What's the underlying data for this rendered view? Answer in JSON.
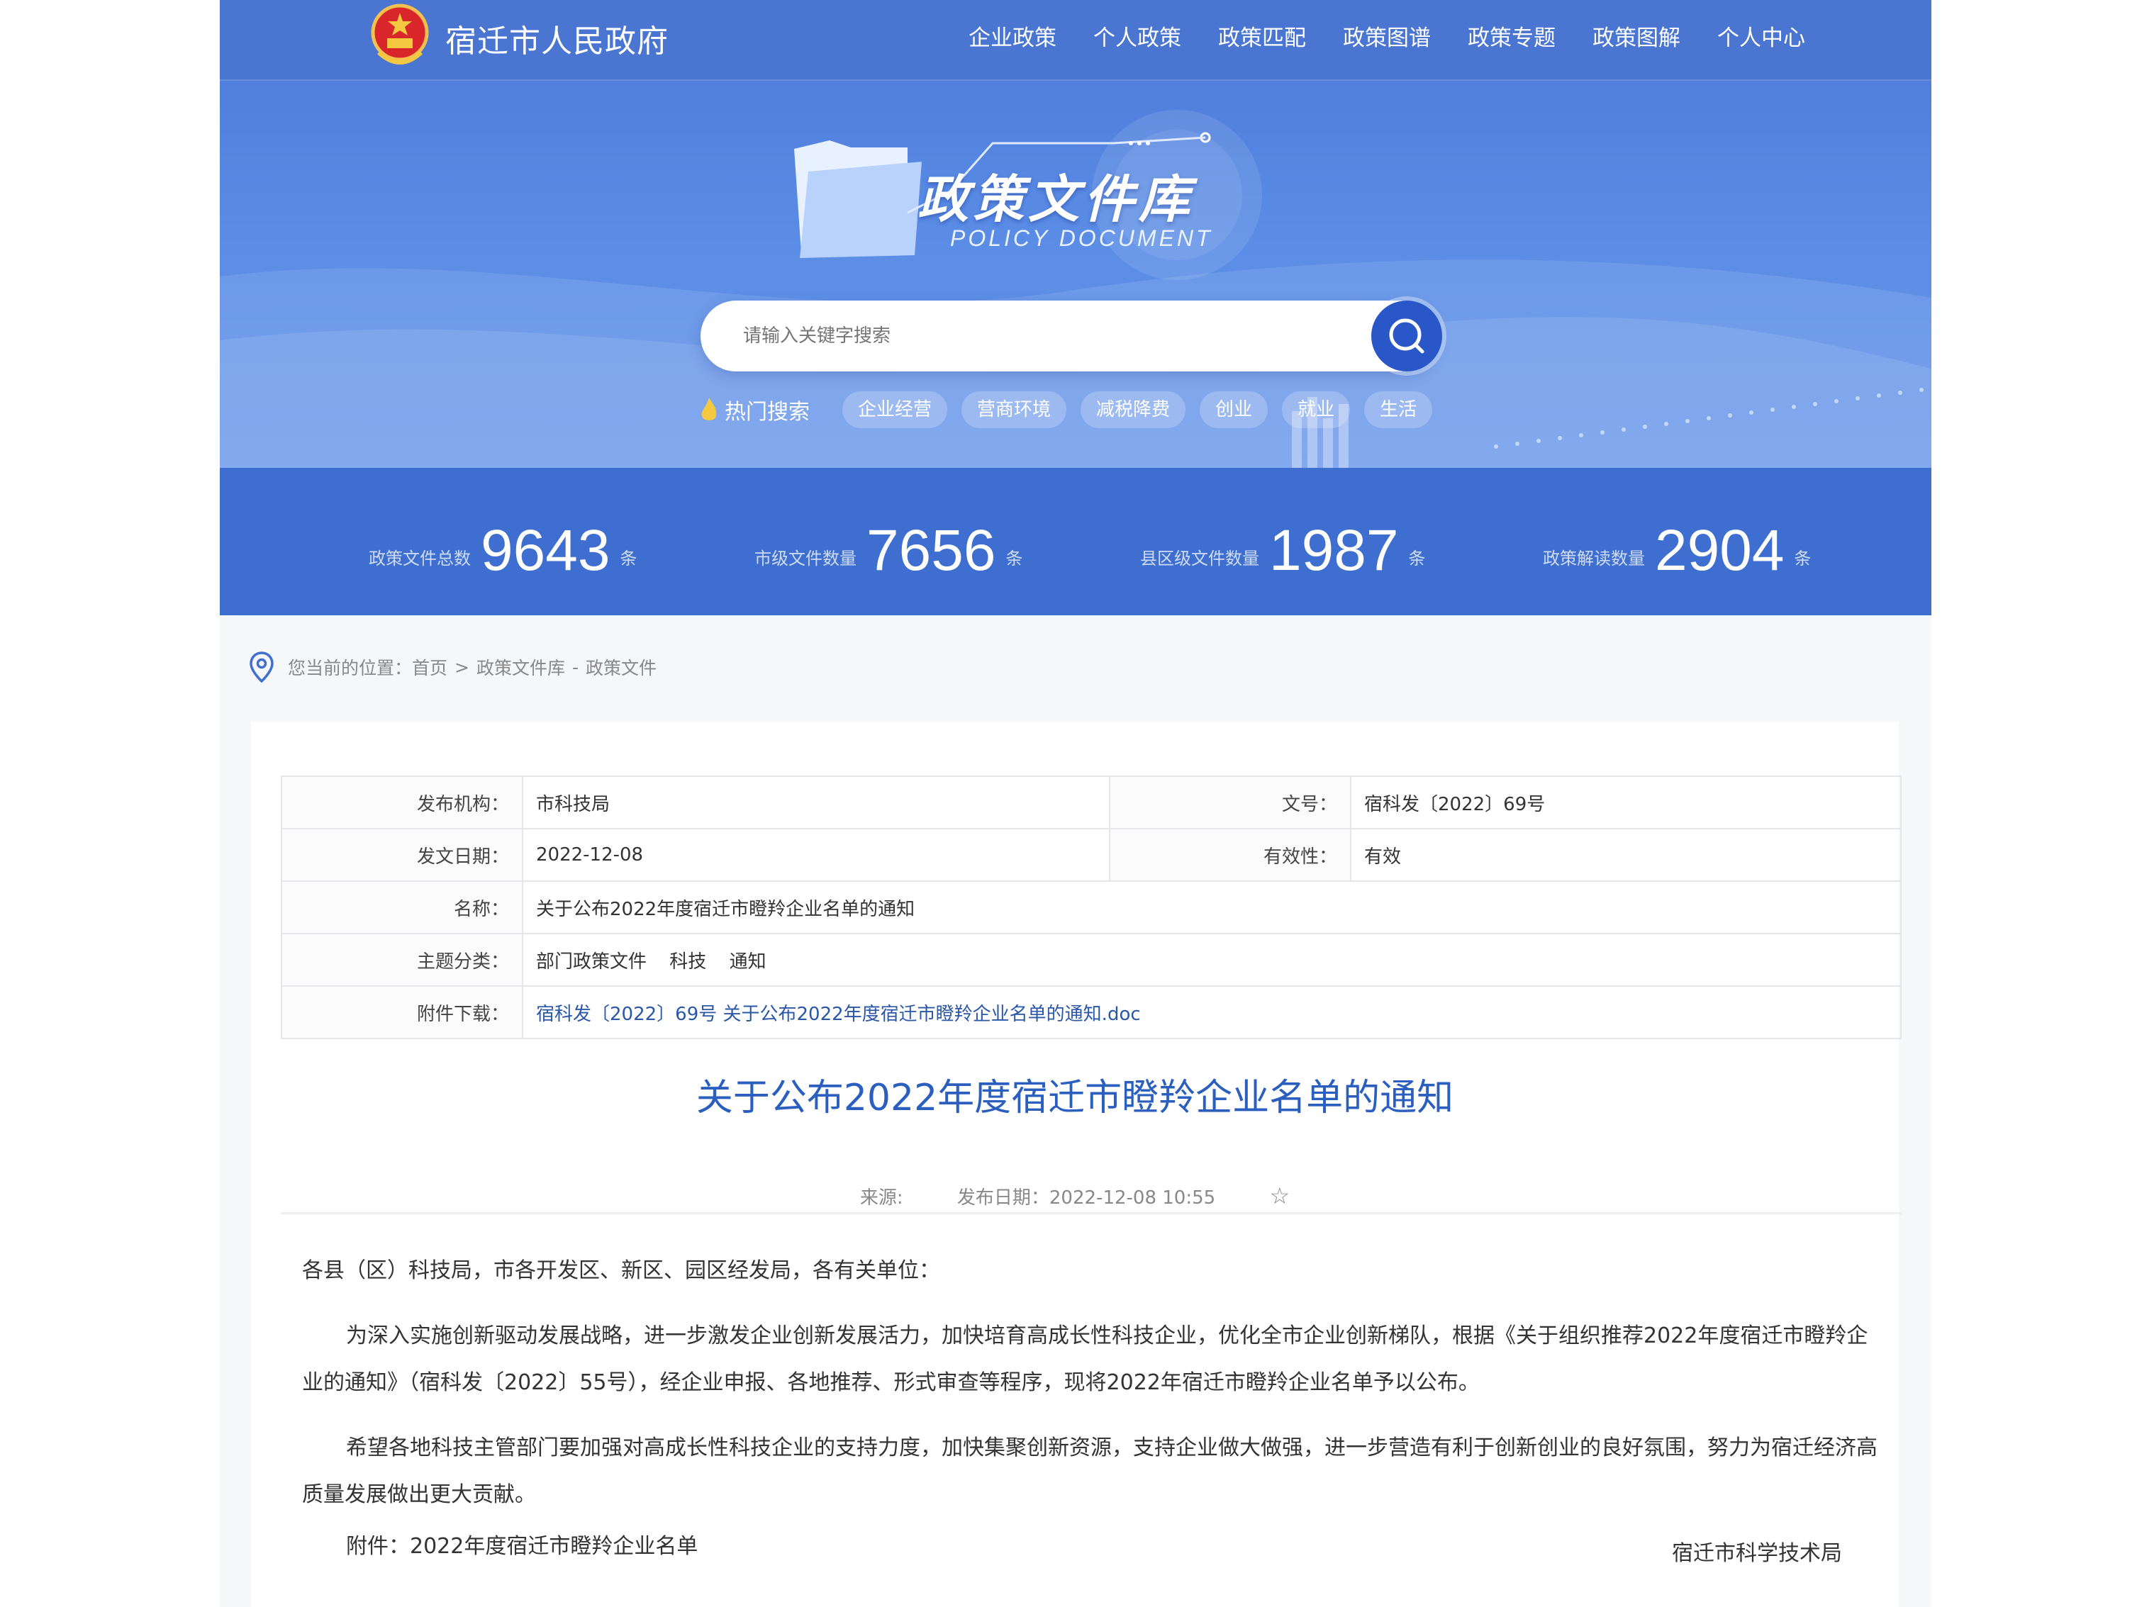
{
  "header": {
    "site_title": "宿迁市人民政府",
    "nav": [
      "企业政策",
      "个人政策",
      "政策匹配",
      "政策图谱",
      "政策专题",
      "政策图解",
      "个人中心"
    ]
  },
  "hero": {
    "logo_cn": "政策文件库",
    "logo_en": "POLICY DOCUMENT",
    "search_placeholder": "请输入关键字搜索",
    "hot_label": "热门搜索",
    "hot_tags": [
      "企业经营",
      "营商环境",
      "减税降费",
      "创业",
      "就业",
      "生活"
    ]
  },
  "stats": [
    {
      "label": "政策文件总数",
      "value": "9643",
      "unit": "条"
    },
    {
      "label": "市级文件数量",
      "value": "7656",
      "unit": "条"
    },
    {
      "label": "县区级文件数量",
      "value": "1987",
      "unit": "条"
    },
    {
      "label": "政策解读数量",
      "value": "2904",
      "unit": "条"
    }
  ],
  "breadcrumb": {
    "prefix": "您当前的位置：",
    "items": [
      "首页",
      "政策文件库",
      "政策文件"
    ],
    "sep1": ">",
    "sep2": "-"
  },
  "meta": {
    "publisher_label": "发布机构：",
    "publisher": "市科技局",
    "docno_label": "文号：",
    "docno": "宿科发〔2022〕69号",
    "date_label": "发文日期：",
    "date": "2022-12-08",
    "validity_label": "有效性：",
    "validity": "有效",
    "name_label": "名称：",
    "name": "关于公布2022年度宿迁市瞪羚企业名单的通知",
    "topic_label": "主题分类：",
    "topics": [
      "部门政策文件",
      "科技",
      "通知"
    ],
    "attach_label": "附件下载：",
    "attach": "宿科发〔2022〕69号 关于公布2022年度宿迁市瞪羚企业名单的通知.doc"
  },
  "document": {
    "title": "关于公布2022年度宿迁市瞪羚企业名单的通知",
    "source_label": "来源:",
    "pubdate": "发布日期：2022-12-08 10:55",
    "star": "☆",
    "salutation": "各县（区）科技局，市各开发区、新区、园区经发局，各有关单位：",
    "para1": "为深入实施创新驱动发展战略，进一步激发企业创新发展活力，加快培育高成长性科技企业，优化全市企业创新梯队，根据《关于组织推荐2022年度宿迁市瞪羚企业的通知》（宿科发〔2022〕55号），经企业申报、各地推荐、形式审查等程序，现将2022年宿迁市瞪羚企业名单予以公布。",
    "para2": "希望各地科技主管部门要加强对高成长性科技企业的支持力度，加快集聚创新资源，支持企业做大做强，进一步营造有利于创新创业的良好氛围，努力为宿迁经济高质量发展做出更大贡献。",
    "attachment": "附件：2022年度宿迁市瞪羚企业名单",
    "signature": "宿迁市科学技术局"
  },
  "colors": {
    "hero": "#4a78d6",
    "stats": "#3e6fd0",
    "title": "#2b5fbf",
    "link": "#2a57a8"
  }
}
